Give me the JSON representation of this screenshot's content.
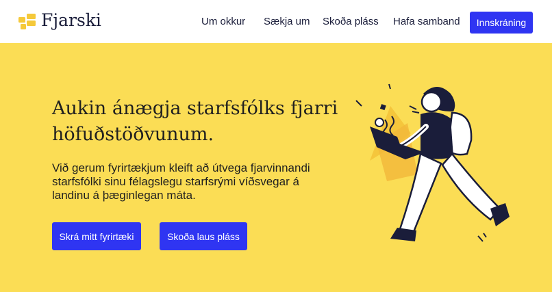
{
  "brand": {
    "name": "Fjarski",
    "logo_icon": "stacked-blocks-icon",
    "color": "#f5c93a"
  },
  "nav": {
    "links": [
      "Um okkur",
      "Sækja um",
      "Skoða pláss",
      "Hafa samband"
    ],
    "login_label": "Innskráning"
  },
  "hero": {
    "title": "Aukin ánægja starfsfólks fjarri höfuðstöðvunum.",
    "subtitle": "Við gerum fyrirtækjum kleift að útvega fjarvinnandi starfsfólki sinu félagslegu starfsrými víðsvegar á landinu á þæginlegan máta.",
    "primary_button": "Skrá mitt fyrirtæki",
    "secondary_button": "Skoða laus pláss",
    "illustration": "person-walking-with-laptop-illustration"
  },
  "colors": {
    "background": "#fbdd55",
    "accent": "#2f35f2",
    "navy": "#1a1d3a"
  }
}
